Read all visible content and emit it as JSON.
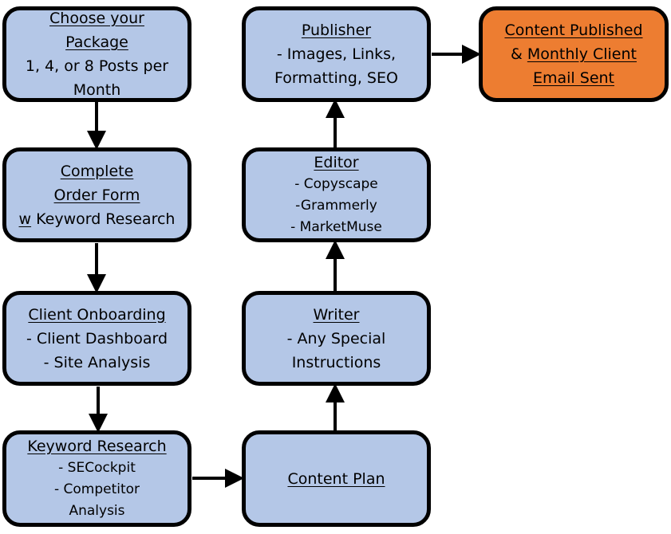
{
  "colors": {
    "step": "#b4c7e7",
    "final": "#ed7d31",
    "border": "#000000"
  },
  "boxes": [
    {
      "id": "choose-package",
      "style": "",
      "lines": [
        [
          {
            "t": "Choose your",
            "u": true
          }
        ],
        [
          {
            "t": "Package",
            "u": true
          }
        ],
        [
          {
            "t": "1, 4, or 8 Posts per",
            "u": false
          }
        ],
        [
          {
            "t": "Month",
            "u": false
          }
        ]
      ]
    },
    {
      "id": "order-form",
      "style": "",
      "lines": [
        [
          {
            "t": "Complete",
            "u": true
          }
        ],
        [
          {
            "t": "Order Form",
            "u": true
          }
        ],
        [
          {
            "t": "w",
            "u": true
          },
          {
            "t": " Keyword Research",
            "u": false
          }
        ]
      ]
    },
    {
      "id": "client-onboarding",
      "style": "",
      "lines": [
        [
          {
            "t": "Client Onboarding",
            "u": true
          }
        ],
        [
          {
            "t": "- Client Dashboard",
            "u": false
          }
        ],
        [
          {
            "t": "- Site Analysis",
            "u": false
          }
        ]
      ]
    },
    {
      "id": "keyword-research",
      "style": "small",
      "lines": [
        [
          {
            "t": "Keyword Research",
            "u": true
          }
        ],
        [
          {
            "t": "- SECockpit",
            "u": false
          }
        ],
        [
          {
            "t": "- Competitor",
            "u": false
          }
        ],
        [
          {
            "t": "Analysis",
            "u": false
          }
        ]
      ]
    },
    {
      "id": "content-plan",
      "style": "",
      "lines": [
        [
          {
            "t": "Content Plan",
            "u": true
          }
        ]
      ]
    },
    {
      "id": "writer",
      "style": "",
      "lines": [
        [
          {
            "t": "Writer",
            "u": true
          }
        ],
        [
          {
            "t": "- Any Special",
            "u": false
          }
        ],
        [
          {
            "t": "Instructions",
            "u": false
          }
        ]
      ]
    },
    {
      "id": "editor",
      "style": "small",
      "lines": [
        [
          {
            "t": "Editor",
            "u": true
          }
        ],
        [
          {
            "t": "- Copyscape",
            "u": false
          }
        ],
        [
          {
            "t": "-Grammerly",
            "u": false
          }
        ],
        [
          {
            "t": "- MarketMuse",
            "u": false
          }
        ]
      ]
    },
    {
      "id": "publisher",
      "style": "",
      "lines": [
        [
          {
            "t": "Publisher",
            "u": true
          }
        ],
        [
          {
            "t": "- Images, Links,",
            "u": false
          }
        ],
        [
          {
            "t": "Formatting, SEO",
            "u": false
          }
        ]
      ]
    },
    {
      "id": "content-published",
      "style": "orange",
      "lines": [
        [
          {
            "t": "Content Published",
            "u": true
          }
        ],
        [
          {
            "t": "& ",
            "u": false
          },
          {
            "t": "Monthly Client",
            "u": true
          }
        ],
        [
          {
            "t": "Email Sent",
            "u": true
          }
        ]
      ]
    }
  ],
  "arrows": [
    [
      "choose-package",
      "order-form"
    ],
    [
      "order-form",
      "client-onboarding"
    ],
    [
      "client-onboarding",
      "keyword-research"
    ],
    [
      "keyword-research",
      "content-plan"
    ],
    [
      "content-plan",
      "writer"
    ],
    [
      "writer",
      "editor"
    ],
    [
      "editor",
      "publisher"
    ],
    [
      "publisher",
      "content-published"
    ]
  ]
}
